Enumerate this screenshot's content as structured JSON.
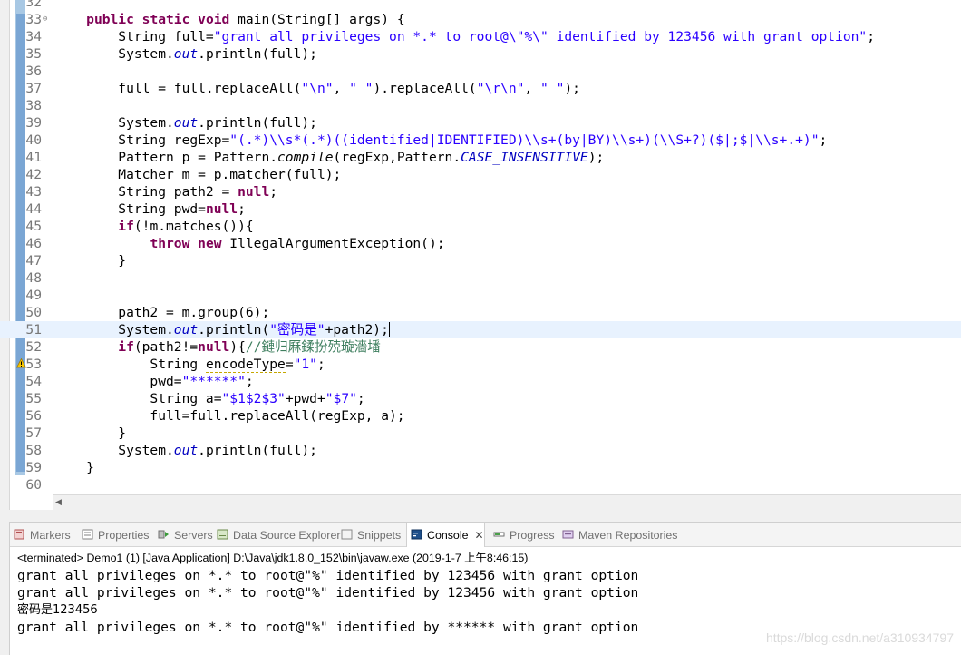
{
  "editor": {
    "lines": [
      {
        "no": "32",
        "html": ""
      },
      {
        "no": "33",
        "fold": "⊖",
        "html": "    <span class=\"kw\">public static void</span> main(String[] args) {"
      },
      {
        "no": "34",
        "html": "        String full=<span class=\"str\">\"grant all privileges on *.* to root@\\\"%\\\" identified by 123456 with grant option\"</span>;"
      },
      {
        "no": "35",
        "html": "        System.<span class=\"fld\">out</span>.println(full);"
      },
      {
        "no": "36",
        "html": ""
      },
      {
        "no": "37",
        "html": "        full = full.replaceAll(<span class=\"str\">\"\\n\"</span>, <span class=\"str\">\" \"</span>).replaceAll(<span class=\"str\">\"\\r\\n\"</span>, <span class=\"str\">\" \"</span>);"
      },
      {
        "no": "38",
        "html": ""
      },
      {
        "no": "39",
        "html": "        System.<span class=\"fld\">out</span>.println(full);"
      },
      {
        "no": "40",
        "html": "        String regExp=<span class=\"str\">\"(.*)\\\\s*(.*)((identified|IDENTIFIED)\\\\s+(by|BY)\\\\s+)(\\\\S+?)($|;$|\\\\s+.+)\"</span>;"
      },
      {
        "no": "41",
        "html": "        Pattern p = Pattern.<span class=\"mth\">compile</span>(regExp,Pattern.<span class=\"fld\">CASE_INSENSITIVE</span>);"
      },
      {
        "no": "42",
        "html": "        Matcher m = p.matcher(full);"
      },
      {
        "no": "43",
        "html": "        String path2 = <span class=\"kw\">null</span>;"
      },
      {
        "no": "44",
        "html": "        String pwd=<span class=\"kw\">null</span>;"
      },
      {
        "no": "45",
        "html": "        <span class=\"kw\">if</span>(!m.matches()){"
      },
      {
        "no": "46",
        "html": "            <span class=\"kw\">throw new</span> IllegalArgumentException();"
      },
      {
        "no": "47",
        "html": "        }"
      },
      {
        "no": "48",
        "html": ""
      },
      {
        "no": "49",
        "html": ""
      },
      {
        "no": "50",
        "html": "        path2 = m.group(6);"
      },
      {
        "no": "51",
        "current": true,
        "html": "        System.<span class=\"fld\">out</span>.println(<span class=\"str\">\"密码是\"</span>+path2);<span class=\"caret\"></span>"
      },
      {
        "no": "52",
        "html": "        <span class=\"kw\">if</span>(path2!=<span class=\"kw\">null</span>){<span class=\"cmt\">//鏈归厤鍒扮殑璇濇墦</span>"
      },
      {
        "no": "53",
        "html": "            String <span class=\"warn-var\">encodeType</span>=<span class=\"str\">\"1\"</span>;"
      },
      {
        "no": "54",
        "html": "            pwd=<span class=\"str\">\"******\"</span>;"
      },
      {
        "no": "55",
        "html": "            String a=<span class=\"str\">\"$1$2$3\"</span>+pwd+<span class=\"str\">\"$7\"</span>;"
      },
      {
        "no": "56",
        "html": "            full=full.replaceAll(regExp, a);"
      },
      {
        "no": "57",
        "html": "        }"
      },
      {
        "no": "58",
        "html": "        System.<span class=\"fld\">out</span>.println(full);"
      },
      {
        "no": "59",
        "html": "    }"
      },
      {
        "no": "60",
        "html": ""
      }
    ]
  },
  "console": {
    "tabs": [
      {
        "label": "Markers",
        "icon": "markers-icon"
      },
      {
        "label": "Properties",
        "icon": "properties-icon"
      },
      {
        "label": "Servers",
        "icon": "servers-icon"
      },
      {
        "label": "Data Source Explorer",
        "icon": "data-source-icon"
      },
      {
        "label": "Snippets",
        "icon": "snippets-icon"
      },
      {
        "label": "Console",
        "icon": "console-icon",
        "active": true
      },
      {
        "label": "Progress",
        "icon": "progress-icon"
      },
      {
        "label": "Maven Repositories",
        "icon": "maven-icon"
      }
    ],
    "status": "<terminated> Demo1 (1) [Java Application] D:\\Java\\jdk1.8.0_152\\bin\\javaw.exe (2019-1-7 上午8:46:15)",
    "output": [
      "grant all privileges on *.* to root@\"%\" identified by 123456 with grant option",
      "grant all privileges on *.* to root@\"%\" identified by 123456 with grant option",
      "密码是123456",
      "grant all privileges on *.* to root@\"%\" identified by ****** with grant option"
    ]
  },
  "watermark": "https://blog.csdn.net/a310934797"
}
